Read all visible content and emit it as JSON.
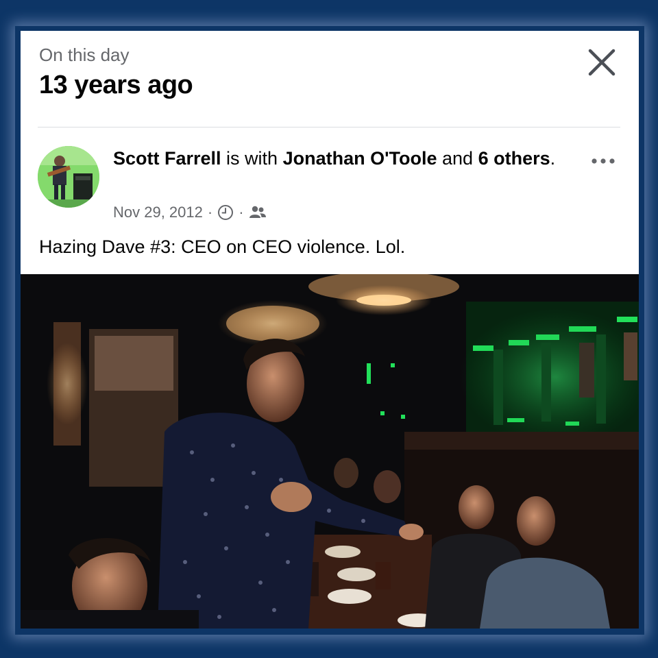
{
  "header": {
    "subtitle": "On this day",
    "title": "13 years ago",
    "close_icon": "close-icon"
  },
  "post": {
    "author": "Scott Farrell",
    "with_text": " is with ",
    "tagged_person": "Jonathan O'Toole",
    "and_text": " and ",
    "others_link": "6 others",
    "period": ".",
    "date": "Nov 29, 2012",
    "separator": "·",
    "time_icon": "clock-icon",
    "audience_icon": "friends-icon",
    "more_icon": "more-options-icon",
    "caption": "Hazing Dave #3:  CEO on CEO violence.  Lol."
  },
  "colors": {
    "page_background": "#0d3566",
    "card_background": "#ffffff",
    "primary_text": "#050505",
    "secondary_text": "#65676b",
    "neon_green": "#22e05a"
  }
}
